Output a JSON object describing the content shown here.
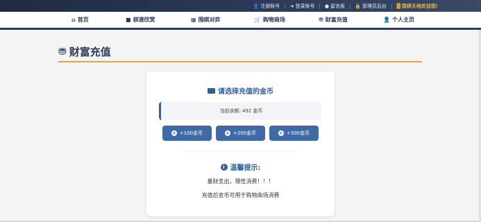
{
  "topbar": {
    "register": "注册账号",
    "login": "登录账号",
    "message_board": "留言板",
    "admin": "管理员后台",
    "welcome": "围棋天地欢迎您!"
  },
  "nav": {
    "home": "首页",
    "classic_games": "棋谱欣赏",
    "go_match": "围棋对弈",
    "shop": "购物商场",
    "recharge": "财富充值",
    "profile": "个人主页"
  },
  "page": {
    "title": "财富充值"
  },
  "card": {
    "title": "请选择充值的金币",
    "balance_label": "当前余额:",
    "balance_value": "492",
    "balance_unit": "金币",
    "buttons": [
      "+100金币",
      "+200金币",
      "+300金币"
    ],
    "tip_title": "温馨提示:",
    "tip_lines": [
      "量财支出，理性消费！！！",
      "充值后金币可用于购物商场消费"
    ]
  },
  "colors": {
    "accent": "#2f5fa0",
    "button": "#3f6aa8",
    "title_underline": "#e8a33d",
    "topbar": "#1f2b44",
    "welcome": "#f0b43c"
  }
}
